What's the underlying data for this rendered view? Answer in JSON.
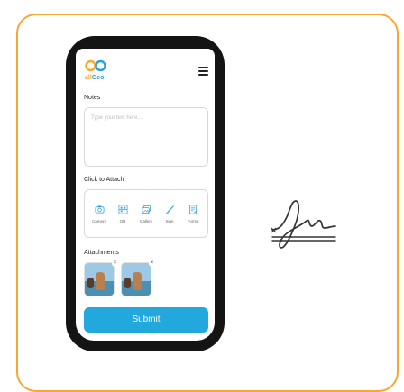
{
  "app": {
    "logo_text_a": "all",
    "logo_text_b": "Geo"
  },
  "notes": {
    "label": "Notes",
    "placeholder": "Type your text here..."
  },
  "attach": {
    "label": "Click to Attach",
    "options": [
      {
        "label": "Camera",
        "icon": "camera-icon"
      },
      {
        "label": "QR",
        "icon": "qr-icon"
      },
      {
        "label": "Gallery",
        "icon": "gallery-icon"
      },
      {
        "label": "Sign",
        "icon": "sign-icon"
      },
      {
        "label": "Forms",
        "icon": "forms-icon"
      }
    ]
  },
  "attachments": {
    "label": "Attachments",
    "count": 2,
    "remove": "×"
  },
  "submit": {
    "label": "Submit"
  },
  "colors": {
    "accent": "#22a8dc",
    "border": "#f5a833",
    "phone": "#141414"
  }
}
